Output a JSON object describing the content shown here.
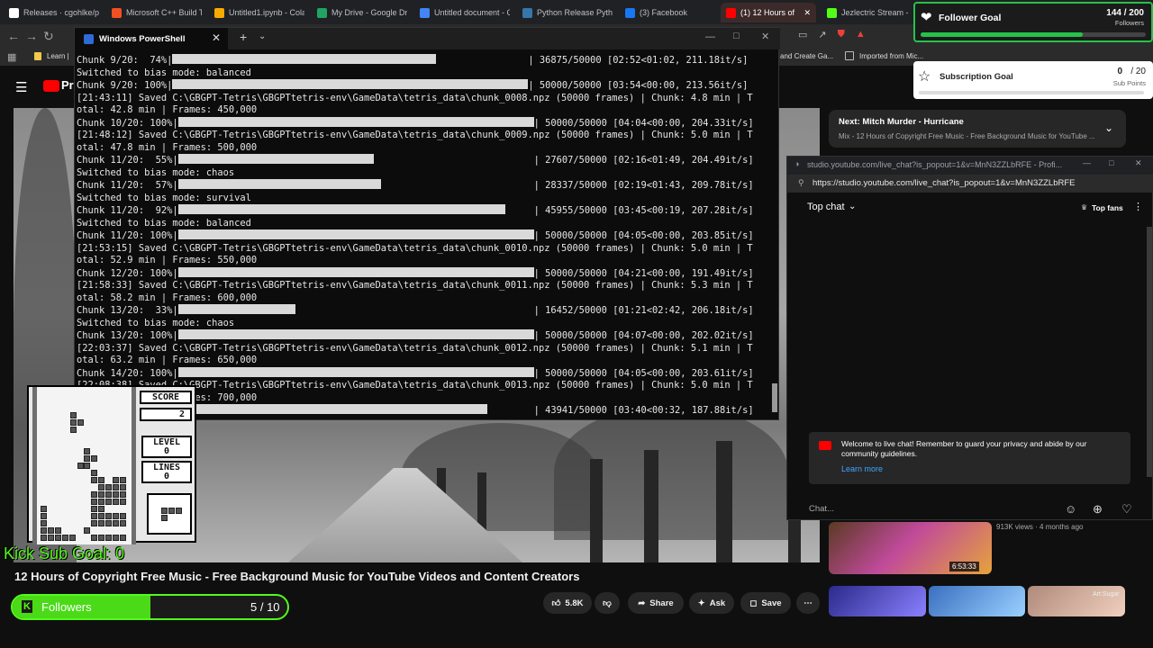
{
  "browser": {
    "tabs": [
      {
        "title": "Releases · cgohlke/pyg",
        "color": "#ffffff"
      },
      {
        "title": "Microsoft C++ Build To",
        "color": "#f25022"
      },
      {
        "title": "Untitled1.ipynb - Colab",
        "color": "#f9ab00"
      },
      {
        "title": "My Drive - Google Driv",
        "color": "#1fa463"
      },
      {
        "title": "Untitled document - G",
        "color": "#4285f4"
      },
      {
        "title": "Python Release Pythor",
        "color": "#3776ab"
      },
      {
        "title": "(3) Facebook",
        "color": "#1877f2"
      },
      {
        "title": "(1) 12 Hours of",
        "color": "#ff0000"
      },
      {
        "title": "Jezlectric Stream - Wa",
        "color": "#53fc18"
      }
    ],
    "bookmarks": [
      {
        "label": "Learn |"
      },
      {
        "label": "and Create Ga..."
      },
      {
        "label": "Imported from Mic..."
      }
    ]
  },
  "powershell": {
    "tab_title": "Windows PowerShell",
    "lines": [
      {
        "pre": "Chunk 9/20:  74%|",
        "bar": 74,
        "post": "| 36875/50000 [02:52<01:02, 211.18it/s]"
      },
      {
        "text": "Switched to bias mode: balanced"
      },
      {
        "pre": "Chunk 9/20: 100%|",
        "bar": 100,
        "post": "| 50000/50000 [03:54<00:00, 213.56it/s]"
      },
      {
        "text": "[21:43:11] Saved C:\\GBGPT-Tetris\\GBGPTtetris-env\\GameData\\tetris_data\\chunk_0008.npz (50000 frames) | Chunk: 4.8 min | T"
      },
      {
        "text": "otal: 42.8 min | Frames: 450,000"
      },
      {
        "pre": "Chunk 10/20: 100%|",
        "bar": 100,
        "post": "| 50000/50000 [04:04<00:00, 204.33it/s]"
      },
      {
        "text": "[21:48:12] Saved C:\\GBGPT-Tetris\\GBGPTtetris-env\\GameData\\tetris_data\\chunk_0009.npz (50000 frames) | Chunk: 5.0 min | T"
      },
      {
        "text": "otal: 47.8 min | Frames: 500,000"
      },
      {
        "pre": "Chunk 11/20:  55%|",
        "bar": 55,
        "post": "| 27607/50000 [02:16<01:49, 204.49it/s]"
      },
      {
        "text": "Switched to bias mode: chaos"
      },
      {
        "pre": "Chunk 11/20:  57%|",
        "bar": 57,
        "post": "| 28337/50000 [02:19<01:43, 209.78it/s]"
      },
      {
        "text": "Switched to bias mode: survival"
      },
      {
        "pre": "Chunk 11/20:  92%|",
        "bar": 92,
        "post": "| 45955/50000 [03:45<00:19, 207.28it/s]"
      },
      {
        "text": "Switched to bias mode: balanced"
      },
      {
        "pre": "Chunk 11/20: 100%|",
        "bar": 100,
        "post": "| 50000/50000 [04:05<00:00, 203.85it/s]"
      },
      {
        "text": "[21:53:15] Saved C:\\GBGPT-Tetris\\GBGPTtetris-env\\GameData\\tetris_data\\chunk_0010.npz (50000 frames) | Chunk: 5.0 min | T"
      },
      {
        "text": "otal: 52.9 min | Frames: 550,000"
      },
      {
        "pre": "Chunk 12/20: 100%|",
        "bar": 100,
        "post": "| 50000/50000 [04:21<00:00, 191.49it/s]"
      },
      {
        "text": "[21:58:33] Saved C:\\GBGPT-Tetris\\GBGPTtetris-env\\GameData\\tetris_data\\chunk_0011.npz (50000 frames) | Chunk: 5.3 min | T"
      },
      {
        "text": "otal: 58.2 min | Frames: 600,000"
      },
      {
        "pre": "Chunk 13/20:  33%|",
        "bar": 33,
        "post": "| 16452/50000 [01:21<02:42, 206.18it/s]"
      },
      {
        "text": "Switched to bias mode: chaos"
      },
      {
        "pre": "Chunk 13/20: 100%|",
        "bar": 100,
        "post": "| 50000/50000 [04:07<00:00, 202.02it/s]"
      },
      {
        "text": "[22:03:37] Saved C:\\GBGPT-Tetris\\GBGPTtetris-env\\GameData\\tetris_data\\chunk_0012.npz (50000 frames) | Chunk: 5.1 min | T"
      },
      {
        "text": "otal: 63.2 min | Frames: 650,000"
      },
      {
        "pre": "Chunk 14/20: 100%|",
        "bar": 100,
        "post": "| 50000/50000 [04:05<00:00, 203.61it/s]"
      },
      {
        "text": "[22:08:38] Saved C:\\GBGPT-Tetris\\GBGPTtetris-env\\GameData\\tetris_data\\chunk_0013.npz (50000 frames) | Chunk: 5.0 min | T"
      },
      {
        "text": "otal: 68.2 min | Frames: 700,000"
      },
      {
        "pre": "Chunk 15/20:  87%|",
        "bar": 87,
        "post": "| 43941/50000 [03:40<00:32, 187.88it/s]"
      }
    ]
  },
  "tetris": {
    "score_label": "SCORE",
    "score_value": "2",
    "level_label": "LEVEL",
    "level_value": "0",
    "lines_label": "LINES",
    "lines_value": "0"
  },
  "follower_goal": {
    "title": "Follower Goal",
    "count": "144 / 200",
    "unit": "Followers",
    "progress": 0.72
  },
  "sub_goal": {
    "title": "Subscription Goal",
    "current": "0",
    "target": "/ 20",
    "unit": "Sub Points",
    "progress": 0
  },
  "kick": {
    "sub_goal_text": "Kick Sub Goal:  0",
    "followers_label": "Followers",
    "followers_count": "5 / 10",
    "progress": 0.5
  },
  "video": {
    "title": "12 Hours of Copyright Free Music - Free Background Music for YouTube Videos and Content Creators",
    "likes": "5.8K",
    "share": "Share",
    "ask": "Ask",
    "save": "Save"
  },
  "next_up": {
    "title": "Next: Mitch Murder - Hurricane",
    "subtitle": "Mix - 12 Hours of Copyright Free Music - Free Background Music for YouTube ..."
  },
  "chat": {
    "window_title": "studio.youtube.com/live_chat?is_popout=1&v=MnN3ZZLbRFE - Profi...",
    "url": "https://studio.youtube.com/live_chat?is_popout=1&v=MnN3ZZLbRFE",
    "mode": "Top chat",
    "badge": "Top fans",
    "welcome": "Welcome to live chat! Remember to guard your privacy and abide by our community guidelines.",
    "learn_more": "Learn more",
    "placeholder": "Chat..."
  },
  "recommended": {
    "views": "913K views · 4 months ago",
    "duration": "6:53:33",
    "badge": "Art:Sugar"
  },
  "colors": {
    "kick_green": "#53fc18",
    "yt_red": "#ff0000"
  }
}
